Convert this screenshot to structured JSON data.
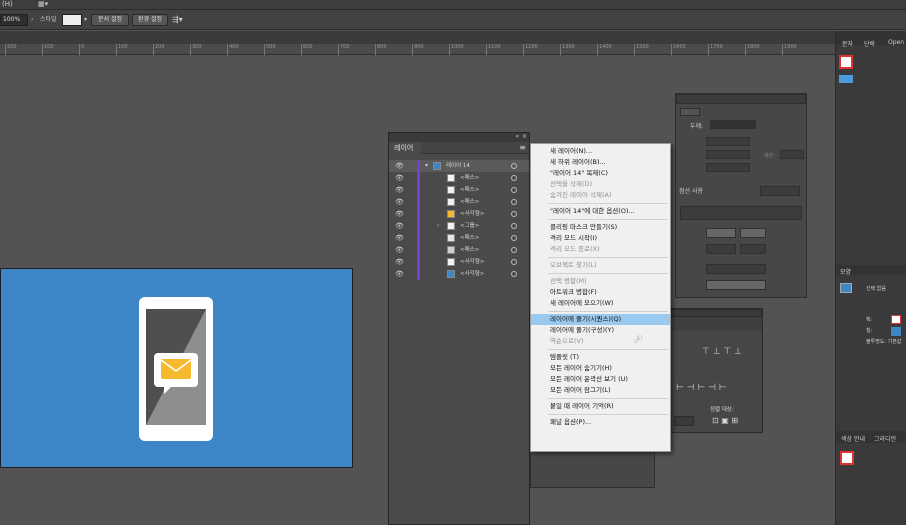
{
  "menubar": {
    "help_fragment": "(H)",
    "workspace_icon": "workspace-switcher-icon"
  },
  "control_bar": {
    "zoom": "100%",
    "style_label": "스타일",
    "doc_setup_button": "문서 설정",
    "prefs_button": "환경 설정"
  },
  "ruler": {
    "ticks": [
      "200",
      "100",
      "0",
      "100",
      "200",
      "300",
      "400",
      "500",
      "600",
      "700",
      "800",
      "900",
      "1000",
      "1100",
      "1200",
      "1300",
      "1400",
      "1500",
      "1600",
      "1700",
      "1800",
      "1900"
    ]
  },
  "layers_panel": {
    "tab_label": "레이어",
    "rows": [
      {
        "name": "레이어 14",
        "kind": "layer",
        "thumb_color": "#3d86c7"
      },
      {
        "name": "<패스>",
        "kind": "path",
        "thumb_color": "#f2f2f2"
      },
      {
        "name": "<패스>",
        "kind": "path",
        "thumb_color": "#f2f2f2"
      },
      {
        "name": "<패스>",
        "kind": "path",
        "thumb_color": "#f2f2f2"
      },
      {
        "name": "<사각형>",
        "kind": "rect",
        "thumb_color": "#f5b82e"
      },
      {
        "name": "<그룹>",
        "kind": "group",
        "thumb_color": "#f2f2f2"
      },
      {
        "name": "<패스>",
        "kind": "path",
        "thumb_color": "#e6e6e6"
      },
      {
        "name": "<패스>",
        "kind": "path",
        "thumb_color": "#d0d0d0"
      },
      {
        "name": "<사각형>",
        "kind": "rect",
        "thumb_color": "#f2f2f2"
      },
      {
        "name": "<사각형>",
        "kind": "rect",
        "thumb_color": "#3d86c7"
      }
    ]
  },
  "context_menu": {
    "items": [
      {
        "label": "새 레이어(N)...",
        "disabled": false
      },
      {
        "label": "새 하위 레이어(B)...",
        "disabled": false
      },
      {
        "label": "\"레이어 14\" 복제(C)",
        "disabled": false
      },
      {
        "label": "선택을 삭제(D)",
        "disabled": true
      },
      {
        "label": "숨겨진 레이어 삭제(A)",
        "disabled": true
      },
      {
        "sep": true
      },
      {
        "label": "\"레이어 14\"에 대한 옵션(O)...",
        "disabled": false
      },
      {
        "sep": true
      },
      {
        "label": "클리핑 마스크 만들기(S)",
        "disabled": false
      },
      {
        "label": "격리 모드 시작(I)",
        "disabled": false
      },
      {
        "label": "격리 모드 종료(X)",
        "disabled": true
      },
      {
        "sep": true
      },
      {
        "label": "오브젝트 찾기(L)",
        "disabled": true
      },
      {
        "sep": true
      },
      {
        "label": "선택 병합(M)",
        "disabled": true
      },
      {
        "label": "아트워크 병합(F)",
        "disabled": false
      },
      {
        "label": "새 레이어에 모으기(W)",
        "disabled": false
      },
      {
        "sep": true
      },
      {
        "label": "레이어에 풀기(시퀀스)(Q)",
        "disabled": false,
        "highlighted": true
      },
      {
        "label": "레이어에 풀기(구성)(Y)",
        "disabled": false
      },
      {
        "label": "역순으로(V)",
        "disabled": true
      },
      {
        "sep": true
      },
      {
        "label": "템플릿 (T)",
        "disabled": false
      },
      {
        "label": "모든 레이어 숨기기(H)",
        "disabled": false
      },
      {
        "label": "모든 레이어 윤곽선 보기 (U)",
        "disabled": false
      },
      {
        "label": "모든 레이어 잠그기(L)",
        "disabled": false
      },
      {
        "sep": true
      },
      {
        "label": "붙일 때 레이어 기억(R)",
        "disabled": false
      },
      {
        "sep": true
      },
      {
        "label": "패널 옵션(P)...",
        "disabled": false
      }
    ]
  },
  "properties_panel": {
    "thickness_label": "두께:",
    "stroke_section": "점선 사용",
    "corner_label": "제한:"
  },
  "align_panel": {
    "align_to_label": "정렬 대상:"
  },
  "right_dock": {
    "tabs": [
      "문자",
      "단락",
      "Open"
    ],
    "layers_tab": "모양",
    "rows": [
      "선택 없음",
      "획:",
      "칠:",
      "불투명도: 기본값"
    ],
    "color_tabs": [
      "색상 안내",
      "그라디언"
    ]
  },
  "colors": {
    "artboard": "#3d86c7",
    "envelope": "#f5b82e",
    "menu_highlight": "#99c9ef",
    "layer_color_bar": "#7a3fd0"
  }
}
